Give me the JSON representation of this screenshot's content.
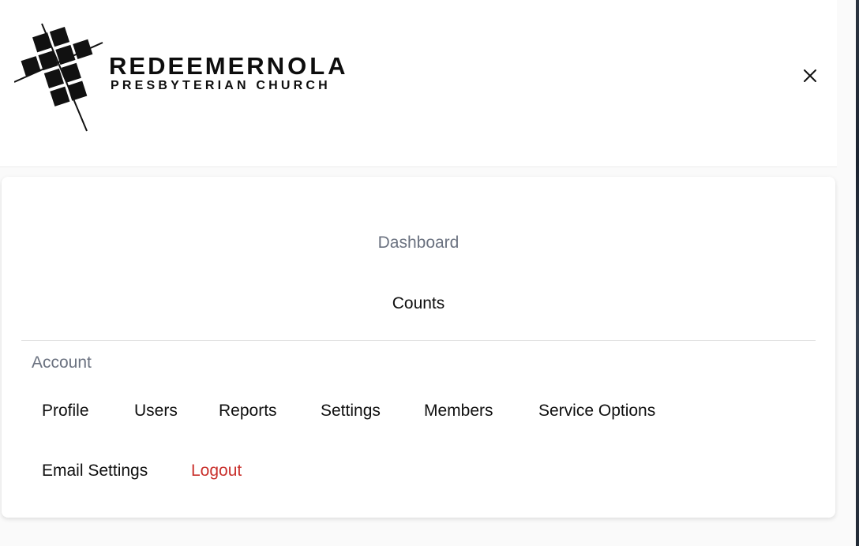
{
  "logo": {
    "line1_a": "REDEEMER",
    "line1_b": "NOLA",
    "line2": "PRESBYTERIAN CHURCH"
  },
  "header": {
    "close_icon": "close-icon"
  },
  "menu": {
    "main_links": [
      {
        "label": "Dashboard"
      },
      {
        "label": "Counts"
      }
    ],
    "account_label": "Account",
    "account_links": [
      {
        "label": "Profile"
      },
      {
        "label": "Users"
      },
      {
        "label": "Reports"
      },
      {
        "label": "Settings"
      },
      {
        "label": "Members"
      },
      {
        "label": "Service Options"
      },
      {
        "label": "Email Settings"
      },
      {
        "label": "Logout"
      }
    ]
  },
  "colors": {
    "muted_text": "#6b7280",
    "primary_text": "#0f0f0f",
    "logout": "#c9302c"
  }
}
